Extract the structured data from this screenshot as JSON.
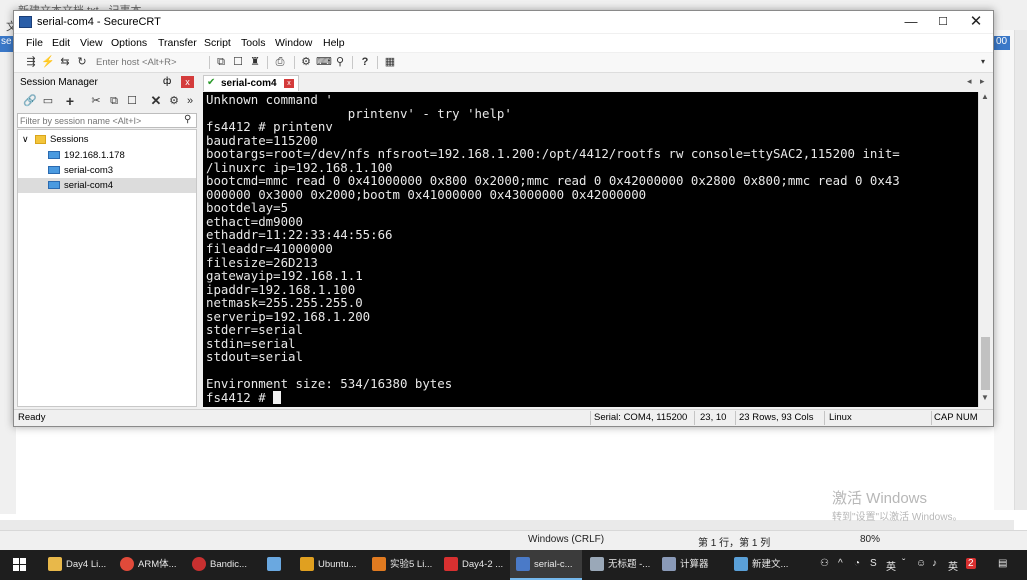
{
  "background_window": {
    "title": "新建文本文档.txt - 记事本",
    "menu_fragment": "文",
    "left_tab": "se",
    "right_tab": "00",
    "status": {
      "encoding": "Windows (CRLF)",
      "position": "第 1 行，第 1 列",
      "zoom": "80%"
    }
  },
  "watermark": {
    "line1": "激活 Windows",
    "line2": "转到\"设置\"以激活 Windows。"
  },
  "window": {
    "title": "serial-com4 - SecureCRT",
    "minimize": "—",
    "maximize": "☐",
    "close": "✕"
  },
  "menu": [
    "File",
    "Edit",
    "View",
    "Options",
    "Transfer",
    "Script",
    "Tools",
    "Window",
    "Help"
  ],
  "toolbar": {
    "host_placeholder": "Enter host <Alt+R>"
  },
  "session_manager": {
    "title": "Session Manager",
    "pin": "ф",
    "close": "x",
    "search_placeholder": "Filter by session name <Alt+I>",
    "tree": {
      "folder": "Sessions",
      "items": [
        "192.168.1.178",
        "serial-com3",
        "serial-com4"
      ],
      "selected": "serial-com4"
    }
  },
  "tab": {
    "label": "serial-com4",
    "close": "x"
  },
  "terminal": {
    "lines": [
      "Unknown command '",
      "                   printenv' - try 'help'",
      "fs4412 # printenv",
      "baudrate=115200",
      "bootargs=root=/dev/nfs nfsroot=192.168.1.200:/opt/4412/rootfs rw console=ttySAC2,115200 init=",
      "/linuxrc ip=192.168.1.100",
      "bootcmd=mmc read 0 0x41000000 0x800 0x2000;mmc read 0 0x42000000 0x2800 0x800;mmc read 0 0x43",
      "000000 0x3000 0x2000;bootm 0x41000000 0x43000000 0x42000000",
      "bootdelay=5",
      "ethact=dm9000",
      "ethaddr=11:22:33:44:55:66",
      "fileaddr=41000000",
      "filesize=26D213",
      "gatewayip=192.168.1.1",
      "ipaddr=192.168.1.100",
      "netmask=255.255.255.0",
      "serverip=192.168.1.200",
      "stderr=serial",
      "stdin=serial",
      "stdout=serial",
      "",
      "Environment size: 534/16380 bytes"
    ],
    "prompt": "fs4412 # "
  },
  "status_bar": {
    "ready": "Ready",
    "serial": "Serial: COM4, 115200",
    "cursor": "23,  10",
    "size": "23 Rows, 93 Cols",
    "os": "Linux",
    "cap": "CAP",
    "num": "NUM"
  },
  "taskbar": {
    "items": [
      "Day4 Li...",
      "ARM体...",
      "Bandic...",
      "",
      "Ubuntu...",
      "实验5 Li...",
      "Day4-2 ...",
      "serial-c...",
      "无标题 -...",
      "计算器",
      "新建文..."
    ],
    "active": "serial-c...",
    "tray": {
      "ime": "英",
      "lang": "英",
      "badge": "2"
    },
    "colors": {
      "taskbar_bg": "#1e1e1e",
      "active_underline": "#76b9ed"
    }
  }
}
